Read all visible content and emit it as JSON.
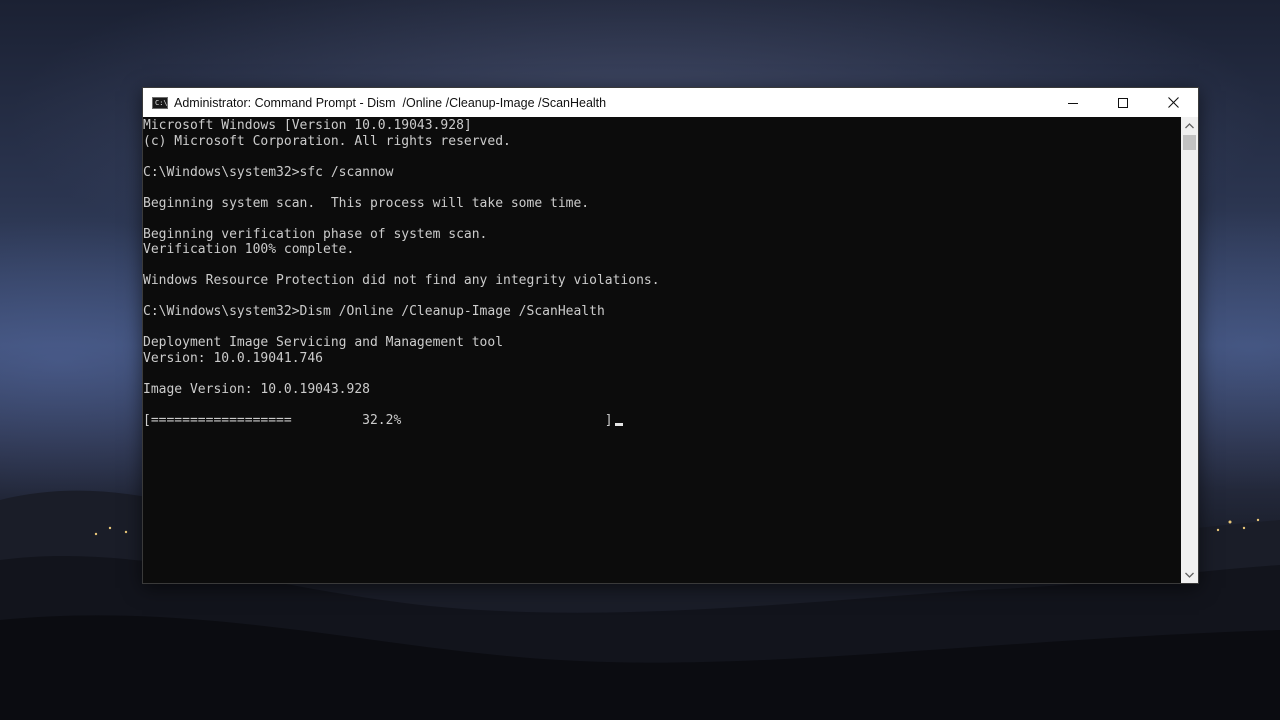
{
  "window": {
    "title": "Administrator: Command Prompt - Dism  /Online /Cleanup-Image /ScanHealth",
    "icon_label": "C:\\",
    "controls": [
      "minimize-icon",
      "maximize-icon",
      "close-icon"
    ]
  },
  "console": {
    "lines": [
      "Microsoft Windows [Version 10.0.19043.928]",
      "(c) Microsoft Corporation. All rights reserved.",
      "",
      "C:\\Windows\\system32>sfc /scannow",
      "",
      "Beginning system scan.  This process will take some time.",
      "",
      "Beginning verification phase of system scan.",
      "Verification 100% complete.",
      "",
      "Windows Resource Protection did not find any integrity violations.",
      "",
      "C:\\Windows\\system32>Dism /Online /Cleanup-Image /ScanHealth",
      "",
      "Deployment Image Servicing and Management tool",
      "Version: 10.0.19041.746",
      "",
      "Image Version: 10.0.19043.928",
      ""
    ],
    "progress_line": "[==================         32.2%                          ]",
    "progress_percent": 32.2
  },
  "colors": {
    "console_bg": "#0c0c0c",
    "console_text": "#cccccc",
    "titlebar_bg": "#ffffff"
  }
}
